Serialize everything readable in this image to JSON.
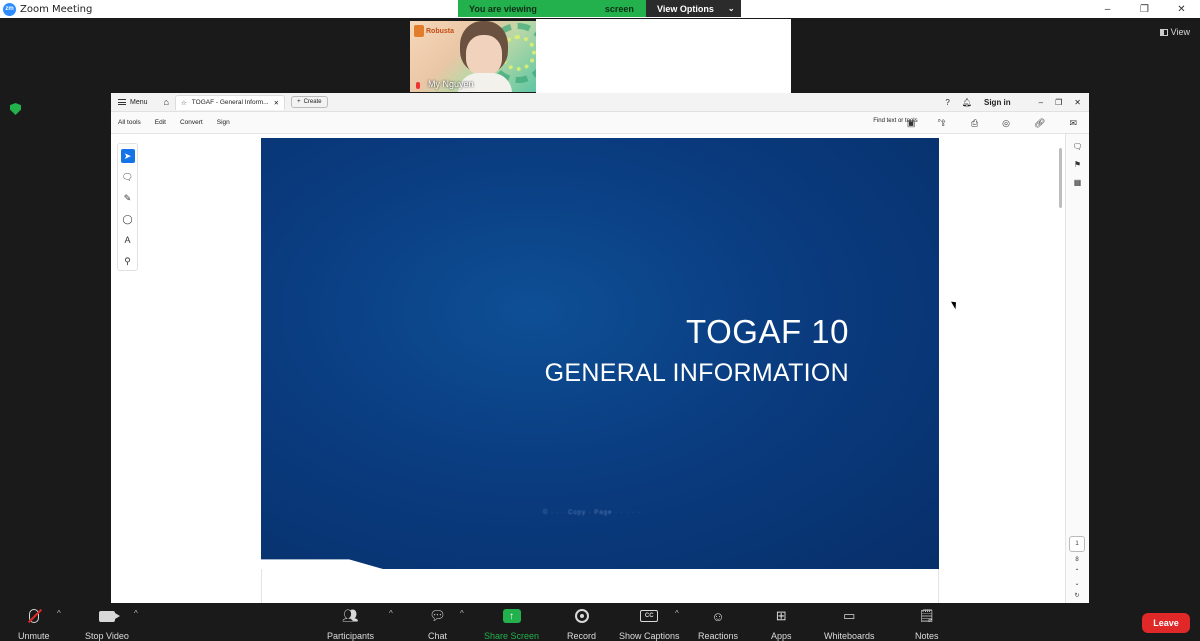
{
  "window": {
    "logo": "zm",
    "title": "Zoom Meeting",
    "controls": [
      "–",
      "❐",
      "✕"
    ]
  },
  "banner": {
    "part1": "You are viewing",
    "part2": "screen",
    "view_options": "View Options",
    "chevron": "⌄"
  },
  "view_button": {
    "label": "View"
  },
  "participant": {
    "name": "My Nguyen",
    "logo_text": "Robusta"
  },
  "acrobat": {
    "menu_label": "Menu",
    "tab_title": "TOGAF - General Inform...",
    "create_label": "Create",
    "sign_in": "Sign in",
    "menus": [
      "All tools",
      "Edit",
      "Convert",
      "Sign"
    ],
    "find_placeholder": "Find text or tools",
    "page_number": "1",
    "page_count": "8"
  },
  "slide": {
    "title": "TOGAF 10",
    "subtitle": "GENERAL INFORMATION",
    "footer": "© · · · Copy ·  Page · · · · ·"
  },
  "toolbar": {
    "unmute": "Unmute",
    "stop_video": "Stop Video",
    "participants": "Participants",
    "chat": "Chat",
    "share_screen": "Share Screen",
    "record": "Record",
    "show_captions": "Show Captions",
    "captions_badge": "CC",
    "reactions": "Reactions",
    "apps": "Apps",
    "whiteboards": "Whiteboards",
    "notes": "Notes",
    "leave": "Leave"
  },
  "colors": {
    "zoom_green": "#22b14c",
    "leave_red": "#e02828",
    "slide_blue": "#0a3c80",
    "acrobat_select": "#1473e6"
  }
}
